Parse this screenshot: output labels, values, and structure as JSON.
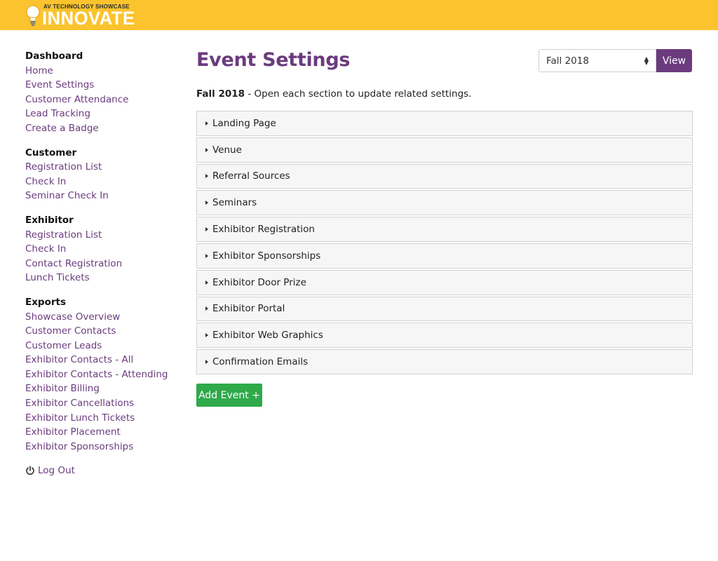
{
  "brand": {
    "subtitle": "AV TECHNOLOGY SHOWCASE",
    "name": "INNOVATE",
    "colors": {
      "header": "#fbc32d",
      "accent": "#6b3b7e",
      "success": "#2eaa4a"
    }
  },
  "sidebar": {
    "groups": [
      {
        "heading": "Dashboard",
        "items": [
          "Home",
          "Event Settings",
          "Customer Attendance",
          "Lead Tracking",
          "Create a Badge"
        ]
      },
      {
        "heading": "Customer",
        "items": [
          "Registration List",
          "Check In",
          "Seminar Check In"
        ]
      },
      {
        "heading": "Exhibitor",
        "items": [
          "Registration List",
          "Check In",
          "Contact Registration",
          "Lunch Tickets"
        ]
      },
      {
        "heading": "Exports",
        "items": [
          "Showcase Overview",
          "Customer Contacts",
          "Customer Leads",
          "Exhibitor Contacts - All",
          "Exhibitor Contacts - Attending",
          "Exhibitor Billing",
          "Exhibitor Cancellations",
          "Exhibitor Lunch Tickets",
          "Exhibitor Placement",
          "Exhibitor Sponsorships"
        ]
      }
    ],
    "logout": {
      "label": "Log Out",
      "icon": "power-icon"
    }
  },
  "main": {
    "title": "Event Settings",
    "event_select": {
      "value": "Fall 2018"
    },
    "view_button": "View",
    "subtitle": {
      "event": "Fall 2018",
      "text": " - Open each section to update related settings."
    },
    "sections": [
      "Landing Page",
      "Venue",
      "Referral Sources",
      "Seminars",
      "Exhibitor Registration",
      "Exhibitor Sponsorships",
      "Exhibitor Door Prize",
      "Exhibitor Portal",
      "Exhibitor Web Graphics",
      "Confirmation Emails"
    ],
    "add_button": "Add Event +"
  }
}
